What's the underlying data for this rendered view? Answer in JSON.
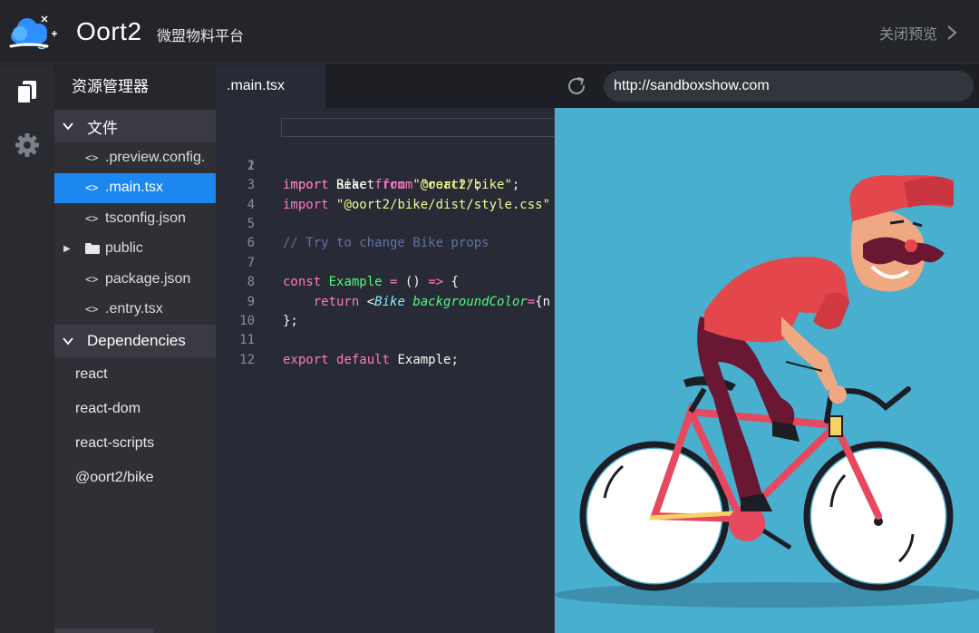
{
  "header": {
    "brand": "Oort2",
    "subtitle": "微盟物料平台",
    "close_preview": "关闭预览"
  },
  "activity_bar": {
    "items": [
      "files-icon",
      "settings-icon"
    ]
  },
  "explorer": {
    "title": "资源管理器",
    "files_section": "文件",
    "files": [
      {
        "name": ".preview.config.",
        "type": "code",
        "active": false
      },
      {
        "name": ".main.tsx",
        "type": "code",
        "active": true
      },
      {
        "name": "tsconfig.json",
        "type": "code",
        "active": false
      },
      {
        "name": "public",
        "type": "folder",
        "active": false
      },
      {
        "name": "package.json",
        "type": "code",
        "active": false
      },
      {
        "name": ".entry.tsx",
        "type": "code",
        "active": false
      }
    ],
    "deps_section": "Dependencies",
    "dependencies": [
      "react",
      "react-dom",
      "react-scripts",
      "@oort2/bike"
    ]
  },
  "editor": {
    "tab": ".main.tsx",
    "line_numbers": [
      "1",
      "2",
      "3",
      "4",
      "5",
      "6",
      "7",
      "8",
      "9",
      "10",
      "11",
      "12"
    ],
    "code": {
      "l1": [
        "import",
        " React ",
        "from",
        " ",
        "\"react\"",
        ";"
      ],
      "l2": [
        "import",
        " Bike ",
        "from",
        " ",
        "\"@oort2/bike\"",
        ";"
      ],
      "l3": [
        "import",
        " ",
        "\"@oort2/bike/dist/style.css\""
      ],
      "l5": "// Try to change Bike props",
      "l7": [
        "const",
        " ",
        "Example",
        " ",
        "=",
        " () ",
        "=>",
        " {"
      ],
      "l8": [
        "    return ",
        "<",
        "Bike",
        " ",
        "backgroundColor",
        "=",
        "{n"
      ],
      "l9": "};",
      "l11": [
        "export",
        " ",
        "default",
        " Example;"
      ]
    }
  },
  "preview": {
    "url": "http://sandboxshow.com",
    "background": "#48afcf"
  },
  "colors": {
    "accent": "#1d87f0",
    "header_bg": "#24252b",
    "editor_bg": "#282a35"
  }
}
